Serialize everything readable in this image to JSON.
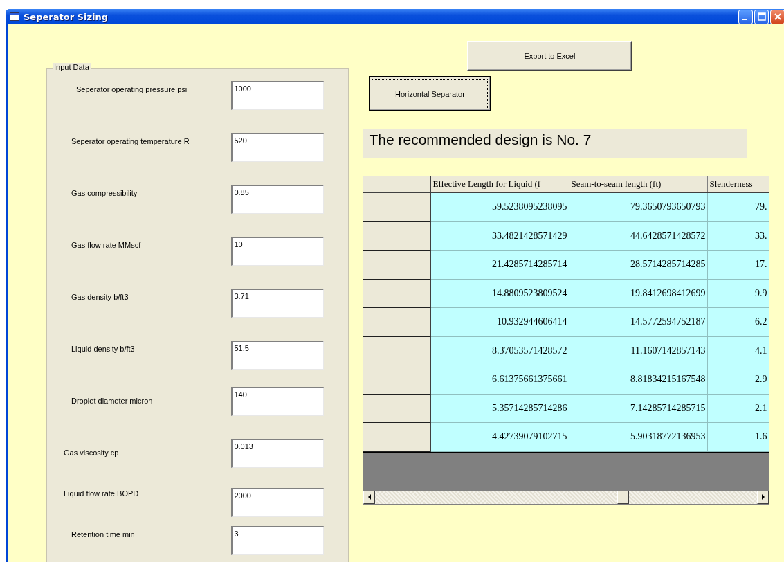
{
  "window": {
    "title": "Seperator Sizing"
  },
  "input_group": {
    "title": "Input Data",
    "fields": [
      {
        "label": "Seperator operating pressure psi",
        "value": "1000"
      },
      {
        "label": "Seperator operating temperature R",
        "value": "520"
      },
      {
        "label": "Gas compressibility",
        "value": "0.85"
      },
      {
        "label": "Gas flow rate MMscf",
        "value": "10"
      },
      {
        "label": "Gas density b/ft3",
        "value": "3.71"
      },
      {
        "label": "Liquid density b/ft3",
        "value": "51.5"
      },
      {
        "label": "Droplet diameter micron",
        "value": "140"
      },
      {
        "label": "Gas viscosity cp",
        "value": "0.013"
      },
      {
        "label": "Liquid flow rate BOPD",
        "value": "2000"
      },
      {
        "label": "Retention time min",
        "value": "3"
      }
    ]
  },
  "buttons": {
    "export": "Export to Excel",
    "separator": "Horizontal Separator"
  },
  "recommendation": "The recommended design is No. 7",
  "table": {
    "columns": [
      "Effective Length for Liquid (f",
      "Seam-to-seam length (ft)",
      "Slenderness"
    ],
    "rows": [
      [
        "59.5238095238095",
        "79.3650793650793",
        "79."
      ],
      [
        "33.4821428571429",
        "44.6428571428572",
        "33."
      ],
      [
        "21.4285714285714",
        "28.5714285714285",
        "17."
      ],
      [
        "14.8809523809524",
        "19.8412698412699",
        "9.9"
      ],
      [
        "10.932944606414",
        "14.5772594752187",
        "6.2"
      ],
      [
        "8.37053571428572",
        "11.1607142857143",
        "4.1"
      ],
      [
        "6.61375661375661",
        "8.81834215167548",
        "2.9"
      ],
      [
        "5.35714285714286",
        "7.14285714285715",
        "2.1"
      ],
      [
        "4.42739079102715",
        "5.90318772136953",
        "1.6"
      ]
    ]
  }
}
